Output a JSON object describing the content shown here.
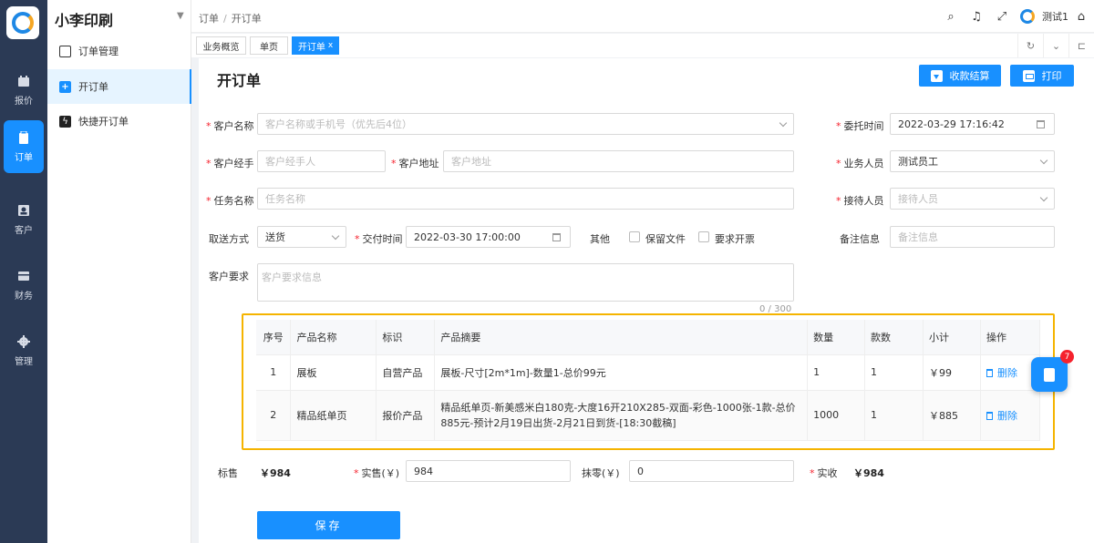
{
  "app": {
    "title": "小李印刷"
  },
  "rail": [
    {
      "label": "报价",
      "icon": "calendar-icon"
    },
    {
      "label": "订单",
      "icon": "clipboard-icon"
    },
    {
      "label": "客户",
      "icon": "contact-icon"
    },
    {
      "label": "财务",
      "icon": "wallet-icon"
    },
    {
      "label": "管理",
      "icon": "gear-icon"
    }
  ],
  "submenu": [
    {
      "label": "订单管理",
      "icon": "document-icon"
    },
    {
      "label": "开订单",
      "icon": "plus-square-icon"
    },
    {
      "label": "快捷开订单",
      "icon": "bolt-icon"
    }
  ],
  "breadcrumb": {
    "first": "订单",
    "sep": "/",
    "second": "开订单"
  },
  "user": {
    "name": "测试1"
  },
  "tabs": [
    {
      "label": "业务概览"
    },
    {
      "label": "单页"
    },
    {
      "label": "开订单",
      "close": "x"
    }
  ],
  "page": {
    "title": "开订单",
    "settle_label": "收款结算",
    "print_label": "打印"
  },
  "form": {
    "customer_name": {
      "label": "客户名称",
      "placeholder": "客户名称或手机号（优先后4位）"
    },
    "entrust_time": {
      "label": "委托时间",
      "value": "2022-03-29 17:16:42"
    },
    "customer_agent": {
      "label": "客户经手",
      "placeholder": "客户经手人"
    },
    "customer_address": {
      "label": "客户地址",
      "placeholder": "客户地址"
    },
    "salesperson": {
      "label": "业务人员",
      "value": "测试员工"
    },
    "task_name": {
      "label": "任务名称",
      "placeholder": "任务名称"
    },
    "receptionist": {
      "label": "接待人员",
      "placeholder": "接待人员"
    },
    "delivery_method": {
      "label": "取送方式",
      "value": "送货"
    },
    "delivery_time": {
      "label": "交付时间",
      "value": "2022-03-30 17:00:00"
    },
    "other": {
      "label": "其他",
      "keep_files": "保留文件",
      "need_invoice": "要求开票"
    },
    "remarks": {
      "label": "备注信息",
      "placeholder": "备注信息"
    },
    "requirements": {
      "label": "客户要求",
      "placeholder": "客户要求信息",
      "counter": "0 / 300"
    }
  },
  "table": {
    "headers": [
      "序号",
      "产品名称",
      "标识",
      "产品摘要",
      "数量",
      "款数",
      "小计",
      "操作"
    ],
    "rows": [
      {
        "no": "1",
        "name": "展板",
        "tag": "自营产品",
        "summary": "展板-尺寸[2m*1m]-数量1-总价99元",
        "qty": "1",
        "styles": "1",
        "subtotal": "￥99",
        "action": "删除"
      },
      {
        "no": "2",
        "name": "精品纸单页",
        "tag": "报价产品",
        "summary": "精品纸单页-新美感米白180克-大度16开210X285-双面-彩色-1000张-1款-总价885元-预计2月19日出货-2月21日到货-[18:30截稿]",
        "qty": "1000",
        "styles": "1",
        "subtotal": "￥885",
        "action": "删除"
      }
    ]
  },
  "totals": {
    "list_label": "标售",
    "list_value": "￥984",
    "actual_sale_label": "实售(￥)",
    "actual_sale_value": "984",
    "rounding_label": "抹零(￥)",
    "rounding_value": "0",
    "received_label": "实收",
    "received_value": "￥984"
  },
  "save_label": "保存",
  "notification_count": "7",
  "colors": {
    "primary": "#1890ff",
    "rail": "#2b3a55",
    "highlight": "#f5b400",
    "required": "#f5222d"
  }
}
